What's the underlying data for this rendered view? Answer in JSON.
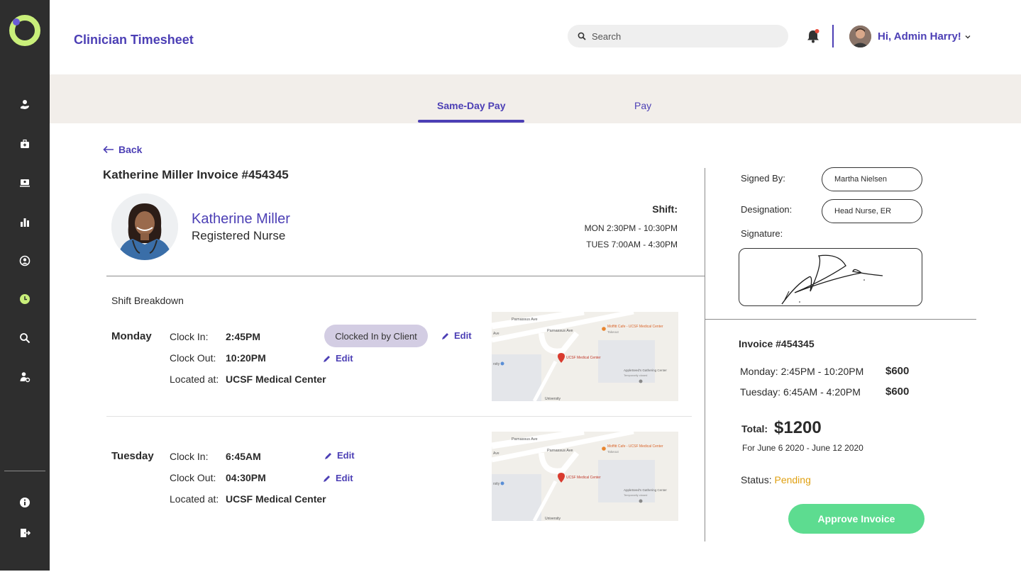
{
  "app": {
    "title": "Clinician Timesheet"
  },
  "header": {
    "search_placeholder": "Search",
    "greeting": "Hi, Admin Harry!"
  },
  "sidebar": {
    "items": [
      {
        "icon": "hand-heart-icon"
      },
      {
        "icon": "medical-bag-icon"
      },
      {
        "icon": "monitor-user-icon"
      },
      {
        "icon": "bar-chart-icon"
      },
      {
        "icon": "user-circle-icon"
      },
      {
        "icon": "clock-icon",
        "active": true
      },
      {
        "icon": "search-icon"
      },
      {
        "icon": "user-settings-icon"
      }
    ],
    "bottom": [
      {
        "icon": "info-icon"
      },
      {
        "icon": "logout-icon"
      }
    ],
    "active_color": "#c9ef7a"
  },
  "tabs": [
    {
      "label": "Same-Day Pay",
      "active": true
    },
    {
      "label": "Pay",
      "active": false
    }
  ],
  "invoice": {
    "back_label": "Back",
    "title": "Katherine Miller Invoice #454345",
    "clinician": {
      "name": "Katherine Miller",
      "role": "Registered Nurse"
    },
    "shift": {
      "label": "Shift:",
      "lines": [
        "MON 2:30PM - 10:30PM",
        "TUES 7:00AM - 4:30PM"
      ]
    },
    "breakdown_title": "Shift Breakdown",
    "days": [
      {
        "day": "Monday",
        "clock_in_label": "Clock In:",
        "clock_in": "2:45PM",
        "clock_out_label": "Clock Out:",
        "clock_out": "10:20PM",
        "location_label": "Located at:",
        "location": "UCSF Medical Center",
        "badge": "Clocked In by Client"
      },
      {
        "day": "Tuesday",
        "clock_in_label": "Clock In:",
        "clock_in": "6:45AM",
        "clock_out_label": "Clock Out:",
        "clock_out": "04:30PM",
        "location_label": "Located at:",
        "location": "UCSF Medical Center"
      }
    ],
    "edit_label": "Edit",
    "map": {
      "street1": "Parnassus Ave",
      "street2": "Parnassus Ave",
      "poi1": "Moffitt Cafe - UCSF Medical Center",
      "poi1_sub": "Takeout",
      "poi2": "UCSF Medical Center",
      "poi3": "AppleSeed's Gathering Center",
      "poi3_sub": "Temporarily closed",
      "bottom": "University",
      "left1": "Ave",
      "left2": "rsity"
    }
  },
  "signoff": {
    "signed_by_label": "Signed By:",
    "signed_by": "Martha Nielsen",
    "designation_label": "Designation:",
    "designation": "Head Nurse, ER",
    "signature_label": "Signature:"
  },
  "summary": {
    "title": "Invoice #454345",
    "lines": [
      {
        "label": "Monday: 2:45PM - 10:20PM",
        "amount": "$600"
      },
      {
        "label": "Tuesday: 6:45AM - 4:20PM",
        "amount": "$600"
      }
    ],
    "total_label": "Total:",
    "total": "$1200",
    "period": "For June 6 2020 - June 12 2020",
    "status_label": "Status:",
    "status": "Pending",
    "status_color": "#e0a011",
    "approve_label": "Approve Invoice",
    "approve_color": "#5ddc90"
  },
  "colors": {
    "brand": "#4c3fb5",
    "sidebar": "#2e2e2e",
    "tabbar": "#f2eeea"
  }
}
